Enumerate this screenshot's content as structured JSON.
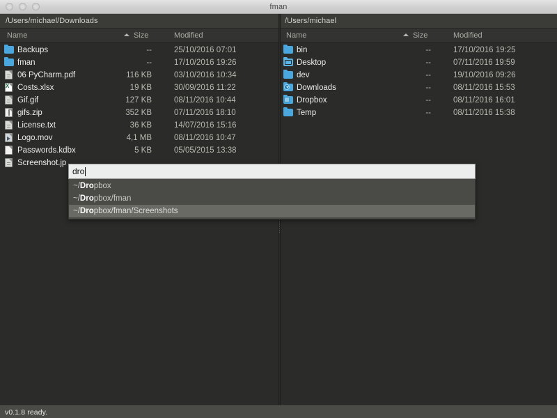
{
  "window": {
    "title": "fman",
    "traffic_lights": [
      "close",
      "minimize",
      "maximize"
    ]
  },
  "columns": {
    "name": "Name",
    "size": "Size",
    "modified": "Modified",
    "sort_column": "Size",
    "sort_direction": "ascending"
  },
  "left_pane": {
    "path": "/Users/michael/Downloads",
    "files": [
      {
        "name": "Backups",
        "size": "--",
        "modified": "25/10/2016 07:01",
        "icon": "folder-icon"
      },
      {
        "name": "fman",
        "size": "--",
        "modified": "17/10/2016 19:26",
        "icon": "folder-icon"
      },
      {
        "name": "06 PyCharm.pdf",
        "size": "116 KB",
        "modified": "03/10/2016 10:34",
        "icon": "pdf-file-icon"
      },
      {
        "name": "Costs.xlsx",
        "size": "19 KB",
        "modified": "30/09/2016 11:22",
        "icon": "excel-file-icon"
      },
      {
        "name": "Gif.gif",
        "size": "127 KB",
        "modified": "08/11/2016 10:44",
        "icon": "image-file-icon"
      },
      {
        "name": "gifs.zip",
        "size": "352 KB",
        "modified": "07/11/2016 18:10",
        "icon": "zip-file-icon"
      },
      {
        "name": "License.txt",
        "size": "36 KB",
        "modified": "14/07/2016 15:16",
        "icon": "text-file-icon"
      },
      {
        "name": "Logo.mov",
        "size": "4,1 MB",
        "modified": "08/11/2016 10:47",
        "icon": "movie-file-icon"
      },
      {
        "name": "Passwords.kdbx",
        "size": "5 KB",
        "modified": "05/05/2015 13:38",
        "icon": "generic-file-icon"
      },
      {
        "name": "Screenshot.jp",
        "size": "",
        "modified": "",
        "icon": "image-file-icon"
      }
    ]
  },
  "right_pane": {
    "path": "/Users/michael",
    "files": [
      {
        "name": "bin",
        "size": "--",
        "modified": "17/10/2016 19:25",
        "icon": "folder-icon"
      },
      {
        "name": "Desktop",
        "size": "--",
        "modified": "07/11/2016 19:59",
        "icon": "desktop-folder-icon"
      },
      {
        "name": "dev",
        "size": "--",
        "modified": "19/10/2016 09:26",
        "icon": "folder-icon"
      },
      {
        "name": "Downloads",
        "size": "--",
        "modified": "08/11/2016 15:53",
        "icon": "downloads-folder-icon"
      },
      {
        "name": "Dropbox",
        "size": "--",
        "modified": "08/11/2016 16:01",
        "icon": "dropbox-folder-icon"
      },
      {
        "name": "Temp",
        "size": "--",
        "modified": "08/11/2016 15:38",
        "icon": "folder-icon"
      }
    ]
  },
  "autocomplete": {
    "input_value": "dro",
    "placeholder": "",
    "match_prefix": "~/",
    "highlight": "Dro",
    "suggestions": [
      {
        "prefix": "~/",
        "match": "Dro",
        "rest": "pbox",
        "selected": false
      },
      {
        "prefix": "~/",
        "match": "Dro",
        "rest": "pbox/fman",
        "selected": false
      },
      {
        "prefix": "~/",
        "match": "Dro",
        "rest": "pbox/fman/Screenshots",
        "selected": true
      }
    ]
  },
  "statusbar": {
    "text": "v0.1.8 ready."
  },
  "colors": {
    "background": "#2b2b29",
    "pathbar": "#3b3b38",
    "header": "#333331",
    "folder_blue": "#4aa8de",
    "selection": "#6a6a65",
    "statusbar": "#4a4a47"
  }
}
